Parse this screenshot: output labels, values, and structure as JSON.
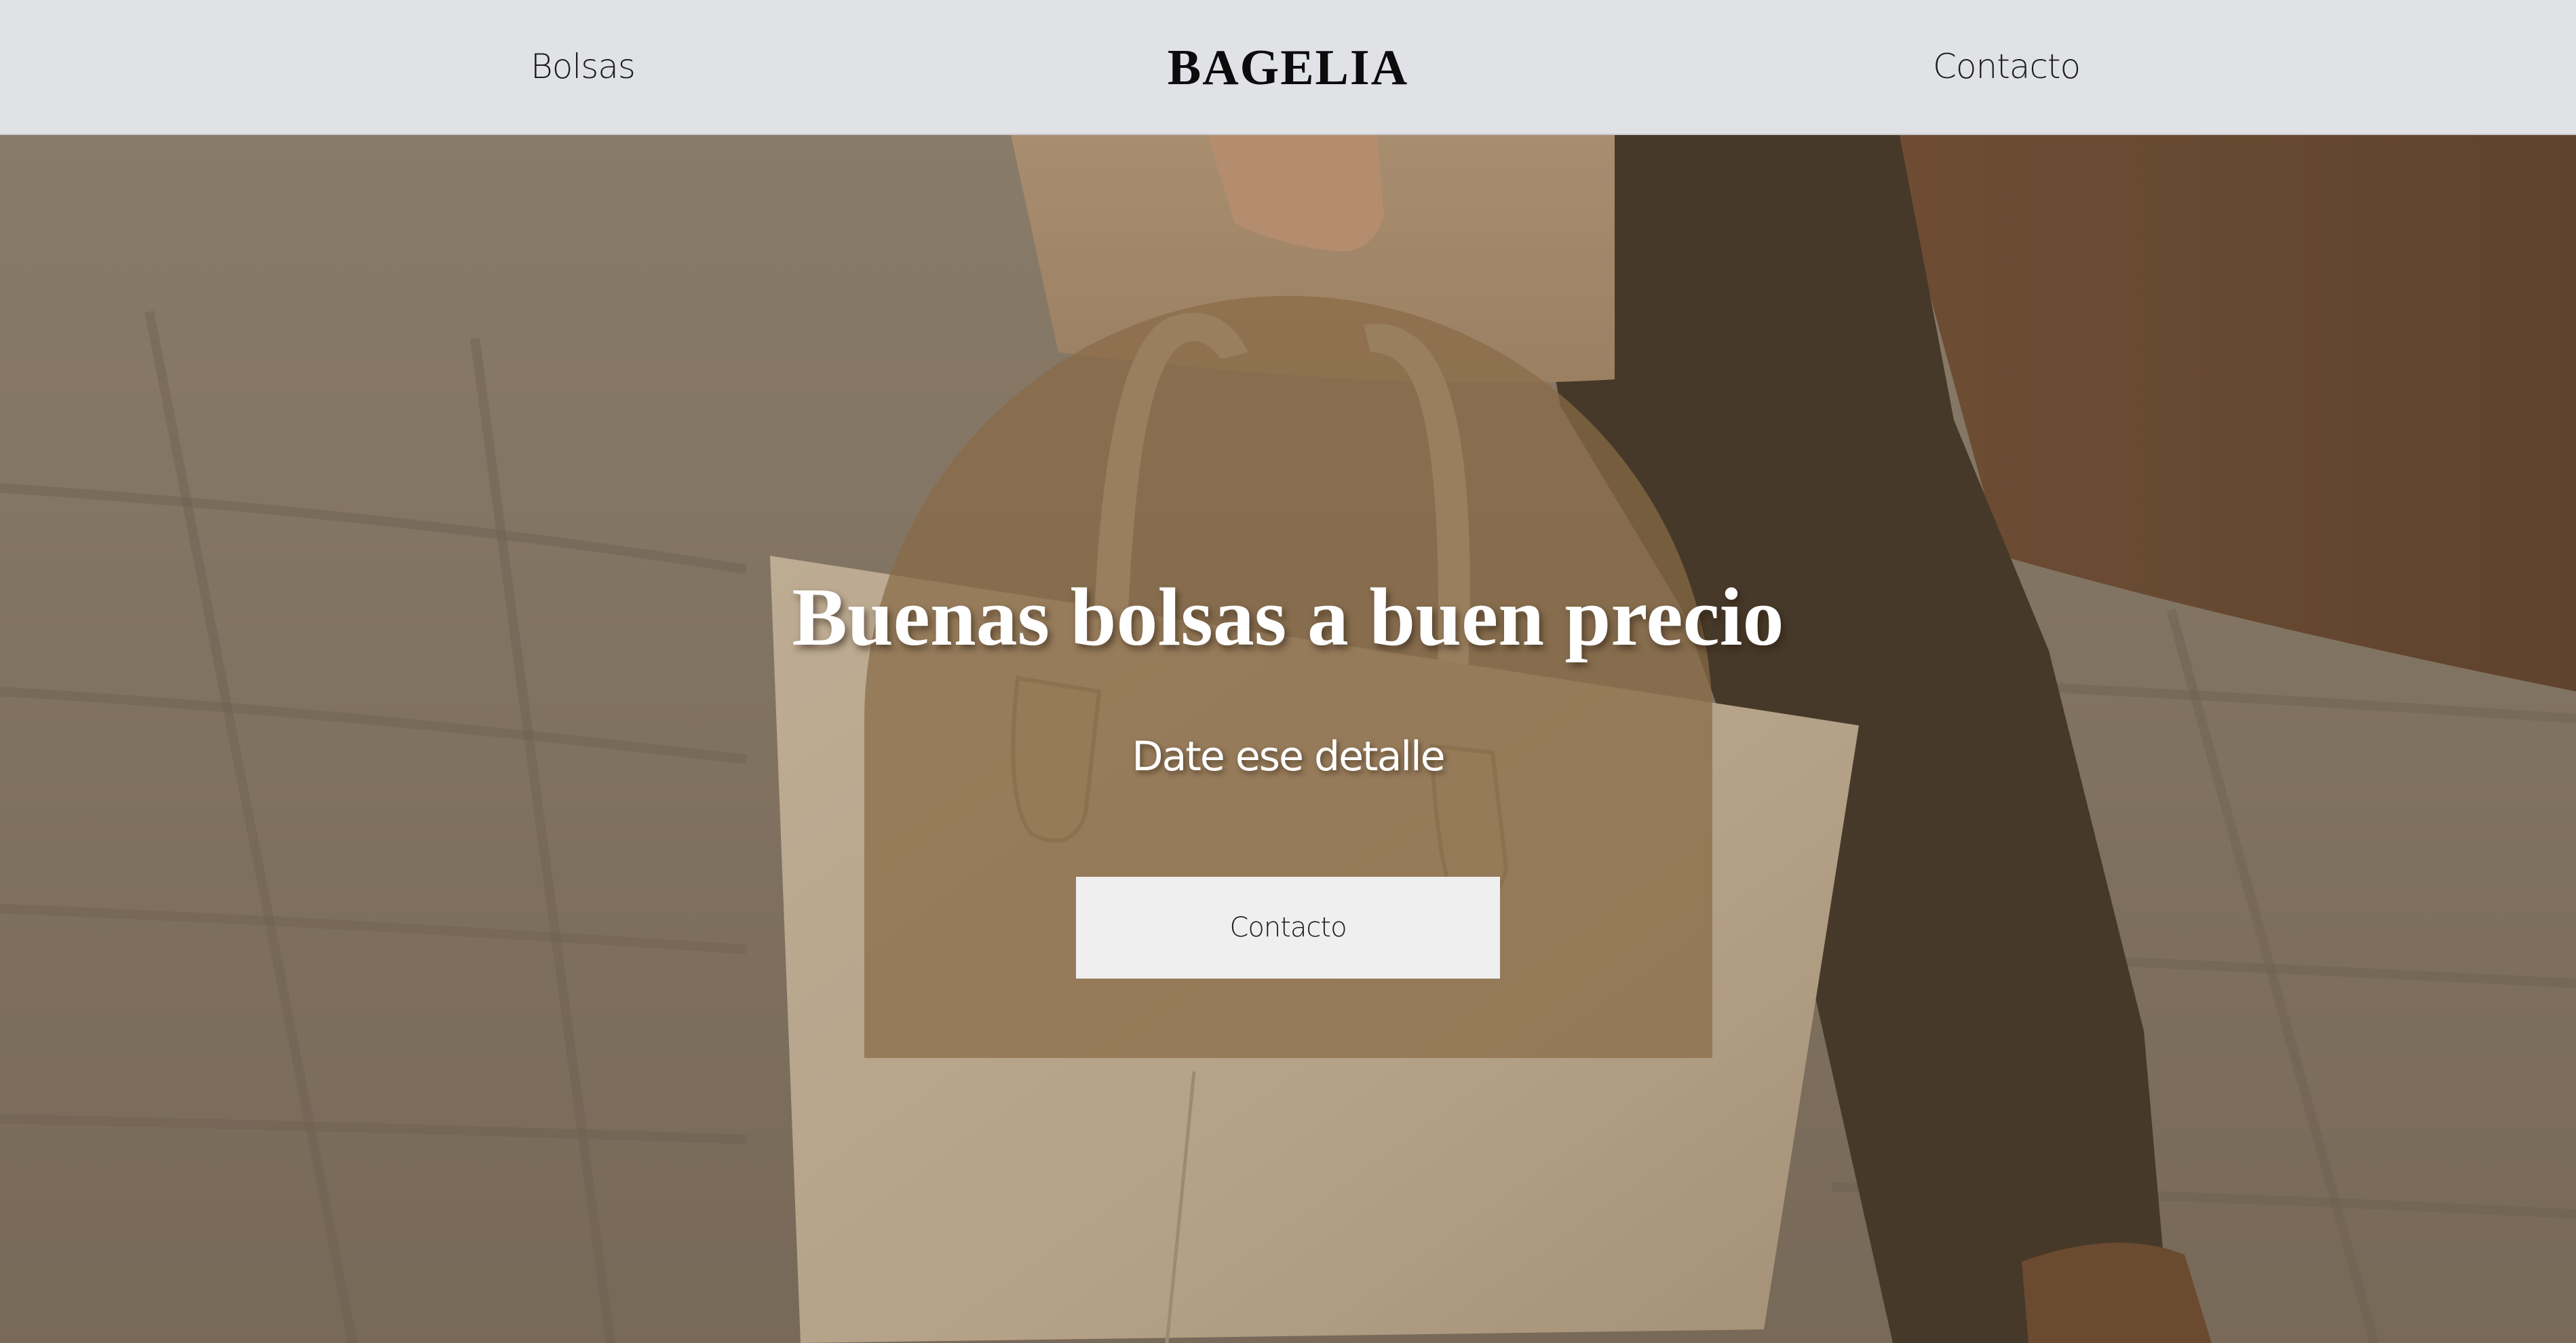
{
  "header": {
    "brand": "BAGELIA",
    "nav_left": "Bolsas",
    "nav_right": "Contacto"
  },
  "hero": {
    "title": "Buenas bolsas a buen precio",
    "subtitle": "Date ese detalle",
    "cta_label": "Contacto"
  },
  "colors": {
    "header_bg": "#e1e2e6",
    "arch_panel": "#896b46",
    "cta_bg": "#efefef",
    "text_light": "#ffffff",
    "text_dark": "#0c0c0c"
  }
}
